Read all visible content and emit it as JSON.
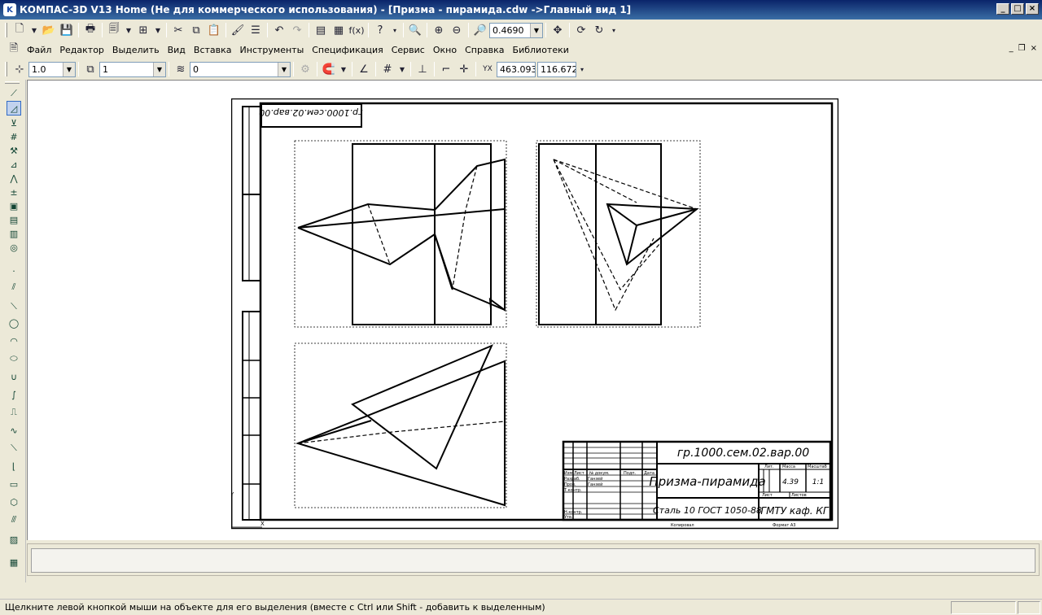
{
  "window": {
    "title": "КОМПАС-3D V13 Home (Не для коммерческого использования) - [Призма - пирамида.cdw ->Главный вид 1]",
    "app_icon_letter": "K"
  },
  "menu": {
    "items": [
      "Файл",
      "Редактор",
      "Выделить",
      "Вид",
      "Вставка",
      "Инструменты",
      "Спецификация",
      "Сервис",
      "Окно",
      "Справка",
      "Библиотеки"
    ]
  },
  "toolbar": {
    "zoom_value": "0.4690"
  },
  "currentbar": {
    "step_value": "1.0",
    "view_value": "1",
    "layer_value": "0",
    "coord_x": "463.093",
    "coord_y": "116.672"
  },
  "drawing": {
    "rotated_stamp": "гр.1000.сем.02.вар.00",
    "designation": "гр.1000.сем.02.вар.00",
    "name": "Призма-пирамида",
    "material": "Сталь 10  ГОСТ 1050-88",
    "organization": "ГМТУ каф. КГ",
    "mass": "4.39",
    "scale": "1:1",
    "header_lit": "Лит.",
    "header_mass": "Масса",
    "header_scale": "Масштаб",
    "sheet_label": "Лист",
    "sheets_label": "Листов",
    "copied": "Копировал",
    "format": "Формат   А3",
    "row_labels": [
      "Изм.",
      "Лист",
      "№ докум.",
      "Подп.",
      "Дата"
    ],
    "row_dev": "Разраб.",
    "row_check": "Пров.",
    "row_tcontrol": "Т.контр.",
    "row_ncontrol": "Н.контр.",
    "row_approve": "Утв.",
    "dev_name": "Ганзей",
    "check_name": "Ганзей",
    "axis_y": "Y",
    "axis_x": "X"
  },
  "status": {
    "hint": "Щелкните левой кнопкой мыши на объекте для его выделения (вместе с Ctrl или Shift - добавить к выделенным)"
  }
}
